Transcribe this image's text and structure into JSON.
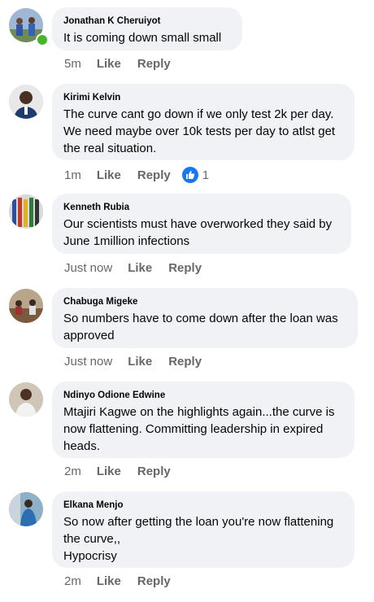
{
  "comments": [
    {
      "author": "Jonathan K Cheruiyot",
      "text": "It is coming down small small",
      "time": "5m",
      "like_label": "Like",
      "reply_label": "Reply",
      "online": true
    },
    {
      "author": "Kirimi Kelvin",
      "text": "The curve cant go down if we only test 2k per day. We need maybe over 10k tests per day to atlst get the real situation.",
      "time": "1m",
      "like_label": "Like",
      "reply_label": "Reply",
      "reaction_count": "1",
      "reaction_icon": "thumbs-up-icon"
    },
    {
      "author": "Kenneth Rubia",
      "text": "Our scientists must have overworked they said by June 1million infections",
      "time": "Just now",
      "like_label": "Like",
      "reply_label": "Reply"
    },
    {
      "author": "Chabuga Migeke",
      "text": "So numbers have to come down after the loan was approved",
      "time": "Just now",
      "like_label": "Like",
      "reply_label": "Reply"
    },
    {
      "author": "Ndinyo Odione Edwine",
      "text": "Mtajiri Kagwe on the highlights again...the curve is now flattening. Committing leadership in expired heads.",
      "time": "2m",
      "like_label": "Like",
      "reply_label": "Reply"
    },
    {
      "author": "Elkana Menjo",
      "text": "So now after getting the loan you're now flattening the curve,,\nHypocrisy",
      "time": "2m",
      "like_label": "Like",
      "reply_label": "Reply"
    }
  ],
  "colors": {
    "bubble": "#f0f2f5",
    "meta": "#65676b",
    "like_blue": "#1877f2",
    "online_green": "#42b72a"
  }
}
